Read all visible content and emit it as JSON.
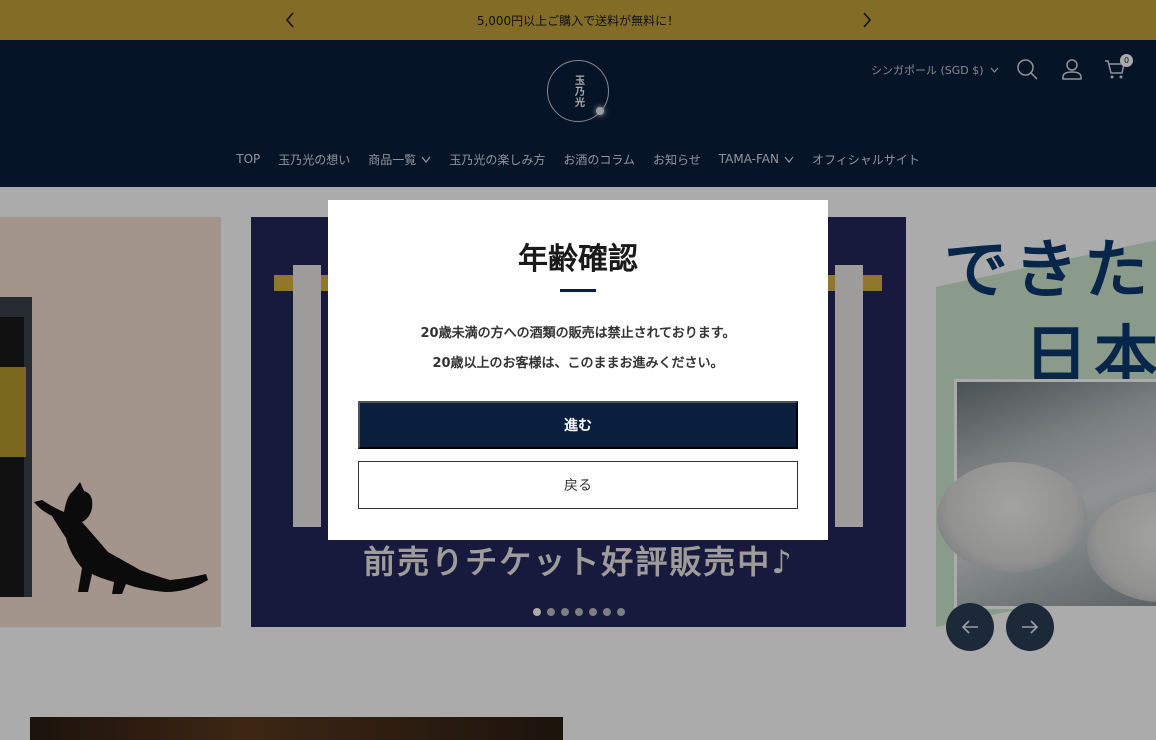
{
  "announcement": {
    "text": "5,000円以上ご購入で送料が無料に！"
  },
  "header": {
    "logo_text": "玉乃光",
    "currency_label": "シンガポール (SGD $)",
    "cart_count": "0"
  },
  "nav": {
    "items": [
      {
        "label": "TOP",
        "dropdown": false
      },
      {
        "label": "玉乃光の想い",
        "dropdown": false
      },
      {
        "label": "商品一覧",
        "dropdown": true
      },
      {
        "label": "玉乃光の楽しみ方",
        "dropdown": false
      },
      {
        "label": "お酒のコラム",
        "dropdown": false
      },
      {
        "label": "お知らせ",
        "dropdown": false
      },
      {
        "label": "TAMA-FAN",
        "dropdown": true
      },
      {
        "label": "オフィシャルサイト",
        "dropdown": false
      }
    ]
  },
  "hero": {
    "center_slide_text": "前売りチケット好評販売中♪",
    "right_slide_line1": "できた",
    "right_slide_line2": "日本",
    "dot_count": 7,
    "active_dot": 0
  },
  "modal": {
    "title": "年齢確認",
    "line1": "20歳未満の方への酒類の販売は禁止されております。",
    "line2": "20歳以上のお客様は、このままお進みください。",
    "enter_label": "進む",
    "back_label": "戻る"
  },
  "colors": {
    "announcement_bg": "#c4a23a",
    "header_bg": "#0a1f3d",
    "primary_button": "#0a1f3d"
  },
  "icons": {
    "announce_prev": "chevron-left-icon",
    "announce_next": "chevron-right-icon",
    "search": "search-icon",
    "account": "user-icon",
    "cart": "cart-icon",
    "hero_prev": "arrow-left-icon",
    "hero_next": "arrow-right-icon"
  }
}
